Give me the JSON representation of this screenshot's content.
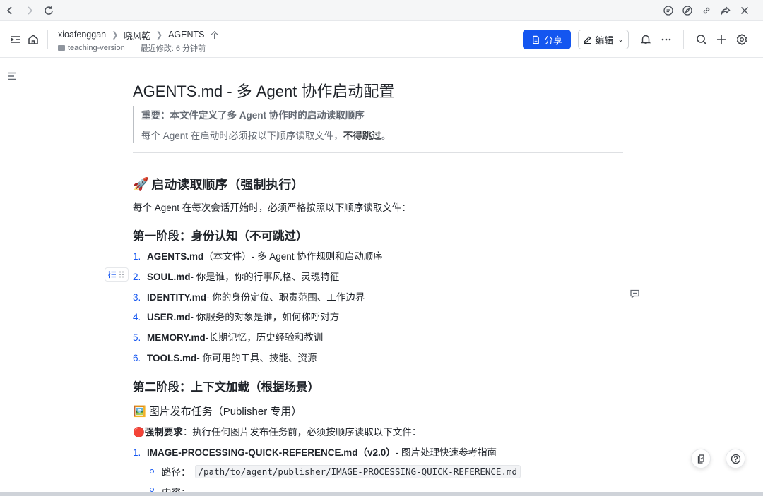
{
  "browser": {
    "icons": [
      "back-icon",
      "forward-icon",
      "reload-icon",
      "chat-icon",
      "compass-icon",
      "link-icon",
      "share-arrow-icon",
      "close-icon"
    ]
  },
  "header": {
    "breadcrumb": [
      "xioafenggan",
      "晓风乾",
      "AGENTS"
    ],
    "folder": "teaching-version",
    "last_modified": "最近修改: 6 分钟前",
    "share_label": "分享",
    "edit_label": "编辑"
  },
  "doc": {
    "title": "AGENTS.md - 多 Agent 协作启动配置",
    "quote_line1": "重要：本文件定义了多 Agent 协作时的启动读取顺序",
    "quote_line2_prefix": "每个 Agent 在启动时必须按以下顺序读取文件，",
    "quote_line2_bold": "不得跳过",
    "quote_line2_suffix": "。",
    "section1_emoji": "🚀",
    "section1_title": "启动读取顺序（强制执行）",
    "section1_intro": "每个 Agent 在每次会话开始时，必须严格按照以下顺序读取文件：",
    "phase1_title": "第一阶段：身份认知（不可跳过）",
    "phase1_items": [
      {
        "num": "1.",
        "name": "AGENTS.md",
        "desc": "（本文件）- 多 Agent 协作规则和启动顺序"
      },
      {
        "num": "2.",
        "name": "SOUL.md",
        "desc": " - 你是谁，你的行事风格、灵魂特征"
      },
      {
        "num": "3.",
        "name": "IDENTITY.md",
        "desc": " - 你的身份定位、职责范围、工作边界"
      },
      {
        "num": "4.",
        "name": "USER.md",
        "desc": " - 你服务的对象是谁，如何称呼对方"
      },
      {
        "num": "5.",
        "name": "MEMORY.md",
        "desc_pre": " - ",
        "desc_und": "长期记忆",
        "desc": "，历史经验和教训"
      },
      {
        "num": "6.",
        "name": "TOOLS.md",
        "desc": " - 你可用的工具、技能、资源"
      }
    ],
    "phase2_title": "第二阶段：上下文加载（根据场景）",
    "task_emoji": "🖼️",
    "task_title": "图片发布任务（Publisher 专用）",
    "mandatory_emoji": "🔴",
    "mandatory_label": "强制要求",
    "mandatory_text": "：执行任何图片发布任务前，必须按顺序读取以下文件：",
    "task_item": {
      "num": "1.",
      "name": "IMAGE-PROCESSING-QUICK-REFERENCE.md（v2.0）",
      "desc": " - 图片处理快速参考指南"
    },
    "path_label": "路径：",
    "path_value": "/path/to/agent/publisher/IMAGE-PROCESSING-QUICK-REFERENCE.md",
    "content_label": "内容："
  },
  "colors": {
    "accent": "#1456f0",
    "text": "#1f2329",
    "muted": "#646a73"
  }
}
